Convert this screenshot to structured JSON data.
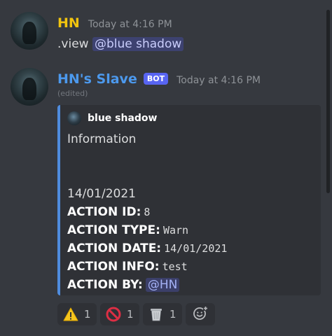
{
  "messages": [
    {
      "author": "HN",
      "timestamp": "Today at 4:16 PM",
      "text_prefix": ".view ",
      "mention": "@blue shadow"
    },
    {
      "author": "HN's Slave",
      "bot_tag": "BOT",
      "timestamp": "Today at 4:16 PM",
      "edited": "(edited)",
      "embed": {
        "author_name": "blue shadow",
        "title_line": "Information",
        "date_line": "14/01/2021",
        "fields": [
          {
            "label": "ACTION ID:",
            "value": "8"
          },
          {
            "label": "ACTION TYPE:",
            "value": "Warn"
          },
          {
            "label": "ACTION DATE:",
            "value": "14/01/2021"
          },
          {
            "label": "ACTION INFO:",
            "value": "test"
          },
          {
            "label": "ACTION BY:",
            "value": "@HN"
          }
        ],
        "accent_color": "#4f8cde"
      },
      "reactions": [
        {
          "icon": "warning-icon",
          "count": "1"
        },
        {
          "icon": "no-entry-sign-icon",
          "count": "1"
        },
        {
          "icon": "wastebasket-icon",
          "count": "1"
        }
      ]
    }
  ],
  "colors": {
    "background": "#36393f",
    "embed_background": "#2f3136",
    "hn_role": "#f1c40f",
    "bot_role": "#4c99ed",
    "bot_tag": "#5865f2",
    "mention": "#c9cdfb"
  }
}
